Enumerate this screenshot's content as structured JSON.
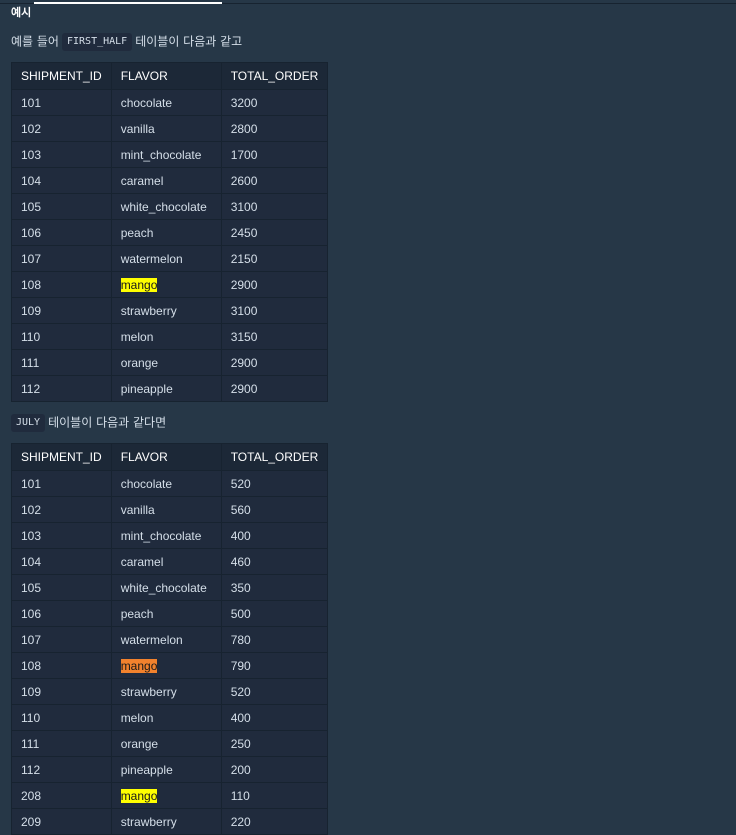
{
  "heading": "예시",
  "intro": {
    "prefix": "예를 들어",
    "code": "FIRST_HALF",
    "suffix": "테이블이 다음과 같고"
  },
  "second_intro": {
    "code": "JULY",
    "suffix": "테이블이 다음과 같다면"
  },
  "table_headers": [
    "SHIPMENT_ID",
    "FLAVOR",
    "TOTAL_ORDER"
  ],
  "first_half_rows": [
    {
      "id": "101",
      "flavor": "chocolate",
      "total": "3200",
      "highlight": ""
    },
    {
      "id": "102",
      "flavor": "vanilla",
      "total": "2800",
      "highlight": ""
    },
    {
      "id": "103",
      "flavor": "mint_chocolate",
      "total": "1700",
      "highlight": ""
    },
    {
      "id": "104",
      "flavor": "caramel",
      "total": "2600",
      "highlight": ""
    },
    {
      "id": "105",
      "flavor": "white_chocolate",
      "total": "3100",
      "highlight": ""
    },
    {
      "id": "106",
      "flavor": "peach",
      "total": "2450",
      "highlight": ""
    },
    {
      "id": "107",
      "flavor": "watermelon",
      "total": "2150",
      "highlight": ""
    },
    {
      "id": "108",
      "flavor": "mango",
      "total": "2900",
      "highlight": "yellow"
    },
    {
      "id": "109",
      "flavor": "strawberry",
      "total": "3100",
      "highlight": ""
    },
    {
      "id": "110",
      "flavor": "melon",
      "total": "3150",
      "highlight": ""
    },
    {
      "id": "111",
      "flavor": "orange",
      "total": "2900",
      "highlight": ""
    },
    {
      "id": "112",
      "flavor": "pineapple",
      "total": "2900",
      "highlight": ""
    }
  ],
  "july_rows": [
    {
      "id": "101",
      "flavor": "chocolate",
      "total": "520",
      "highlight": ""
    },
    {
      "id": "102",
      "flavor": "vanilla",
      "total": "560",
      "highlight": ""
    },
    {
      "id": "103",
      "flavor": "mint_chocolate",
      "total": "400",
      "highlight": ""
    },
    {
      "id": "104",
      "flavor": "caramel",
      "total": "460",
      "highlight": ""
    },
    {
      "id": "105",
      "flavor": "white_chocolate",
      "total": "350",
      "highlight": ""
    },
    {
      "id": "106",
      "flavor": "peach",
      "total": "500",
      "highlight": ""
    },
    {
      "id": "107",
      "flavor": "watermelon",
      "total": "780",
      "highlight": ""
    },
    {
      "id": "108",
      "flavor": "mango",
      "total": "790",
      "highlight": "orange"
    },
    {
      "id": "109",
      "flavor": "strawberry",
      "total": "520",
      "highlight": ""
    },
    {
      "id": "110",
      "flavor": "melon",
      "total": "400",
      "highlight": ""
    },
    {
      "id": "111",
      "flavor": "orange",
      "total": "250",
      "highlight": ""
    },
    {
      "id": "112",
      "flavor": "pineapple",
      "total": "200",
      "highlight": ""
    },
    {
      "id": "208",
      "flavor": "mango",
      "total": "110",
      "highlight": "yellow"
    },
    {
      "id": "209",
      "flavor": "strawberry",
      "total": "220",
      "highlight": ""
    }
  ],
  "colors": {
    "background": "#263747",
    "cell": "#202b3d",
    "header_cell": "#1c2837",
    "highlight_yellow": "#ffff00",
    "highlight_orange": "#f2822d"
  }
}
